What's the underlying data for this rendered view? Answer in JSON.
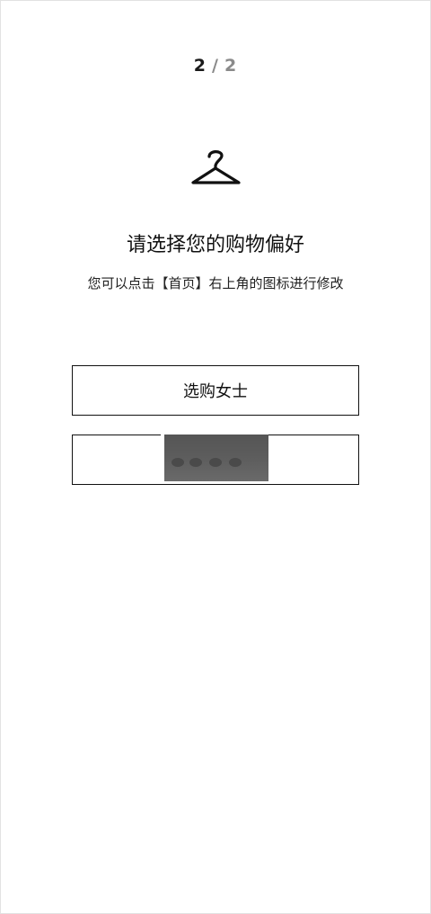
{
  "progress": {
    "current": "2",
    "separator": "/",
    "total": "2"
  },
  "icon": "hanger-icon",
  "title": "请选择您的购物偏好",
  "subtitle": "您可以点击【首页】右上角的图标进行修改",
  "options": [
    {
      "label": "选购女士"
    },
    {
      "label": ""
    }
  ],
  "colors": {
    "text": "#111111",
    "muted": "#8a8a8a",
    "border": "#111111",
    "background": "#ffffff"
  }
}
